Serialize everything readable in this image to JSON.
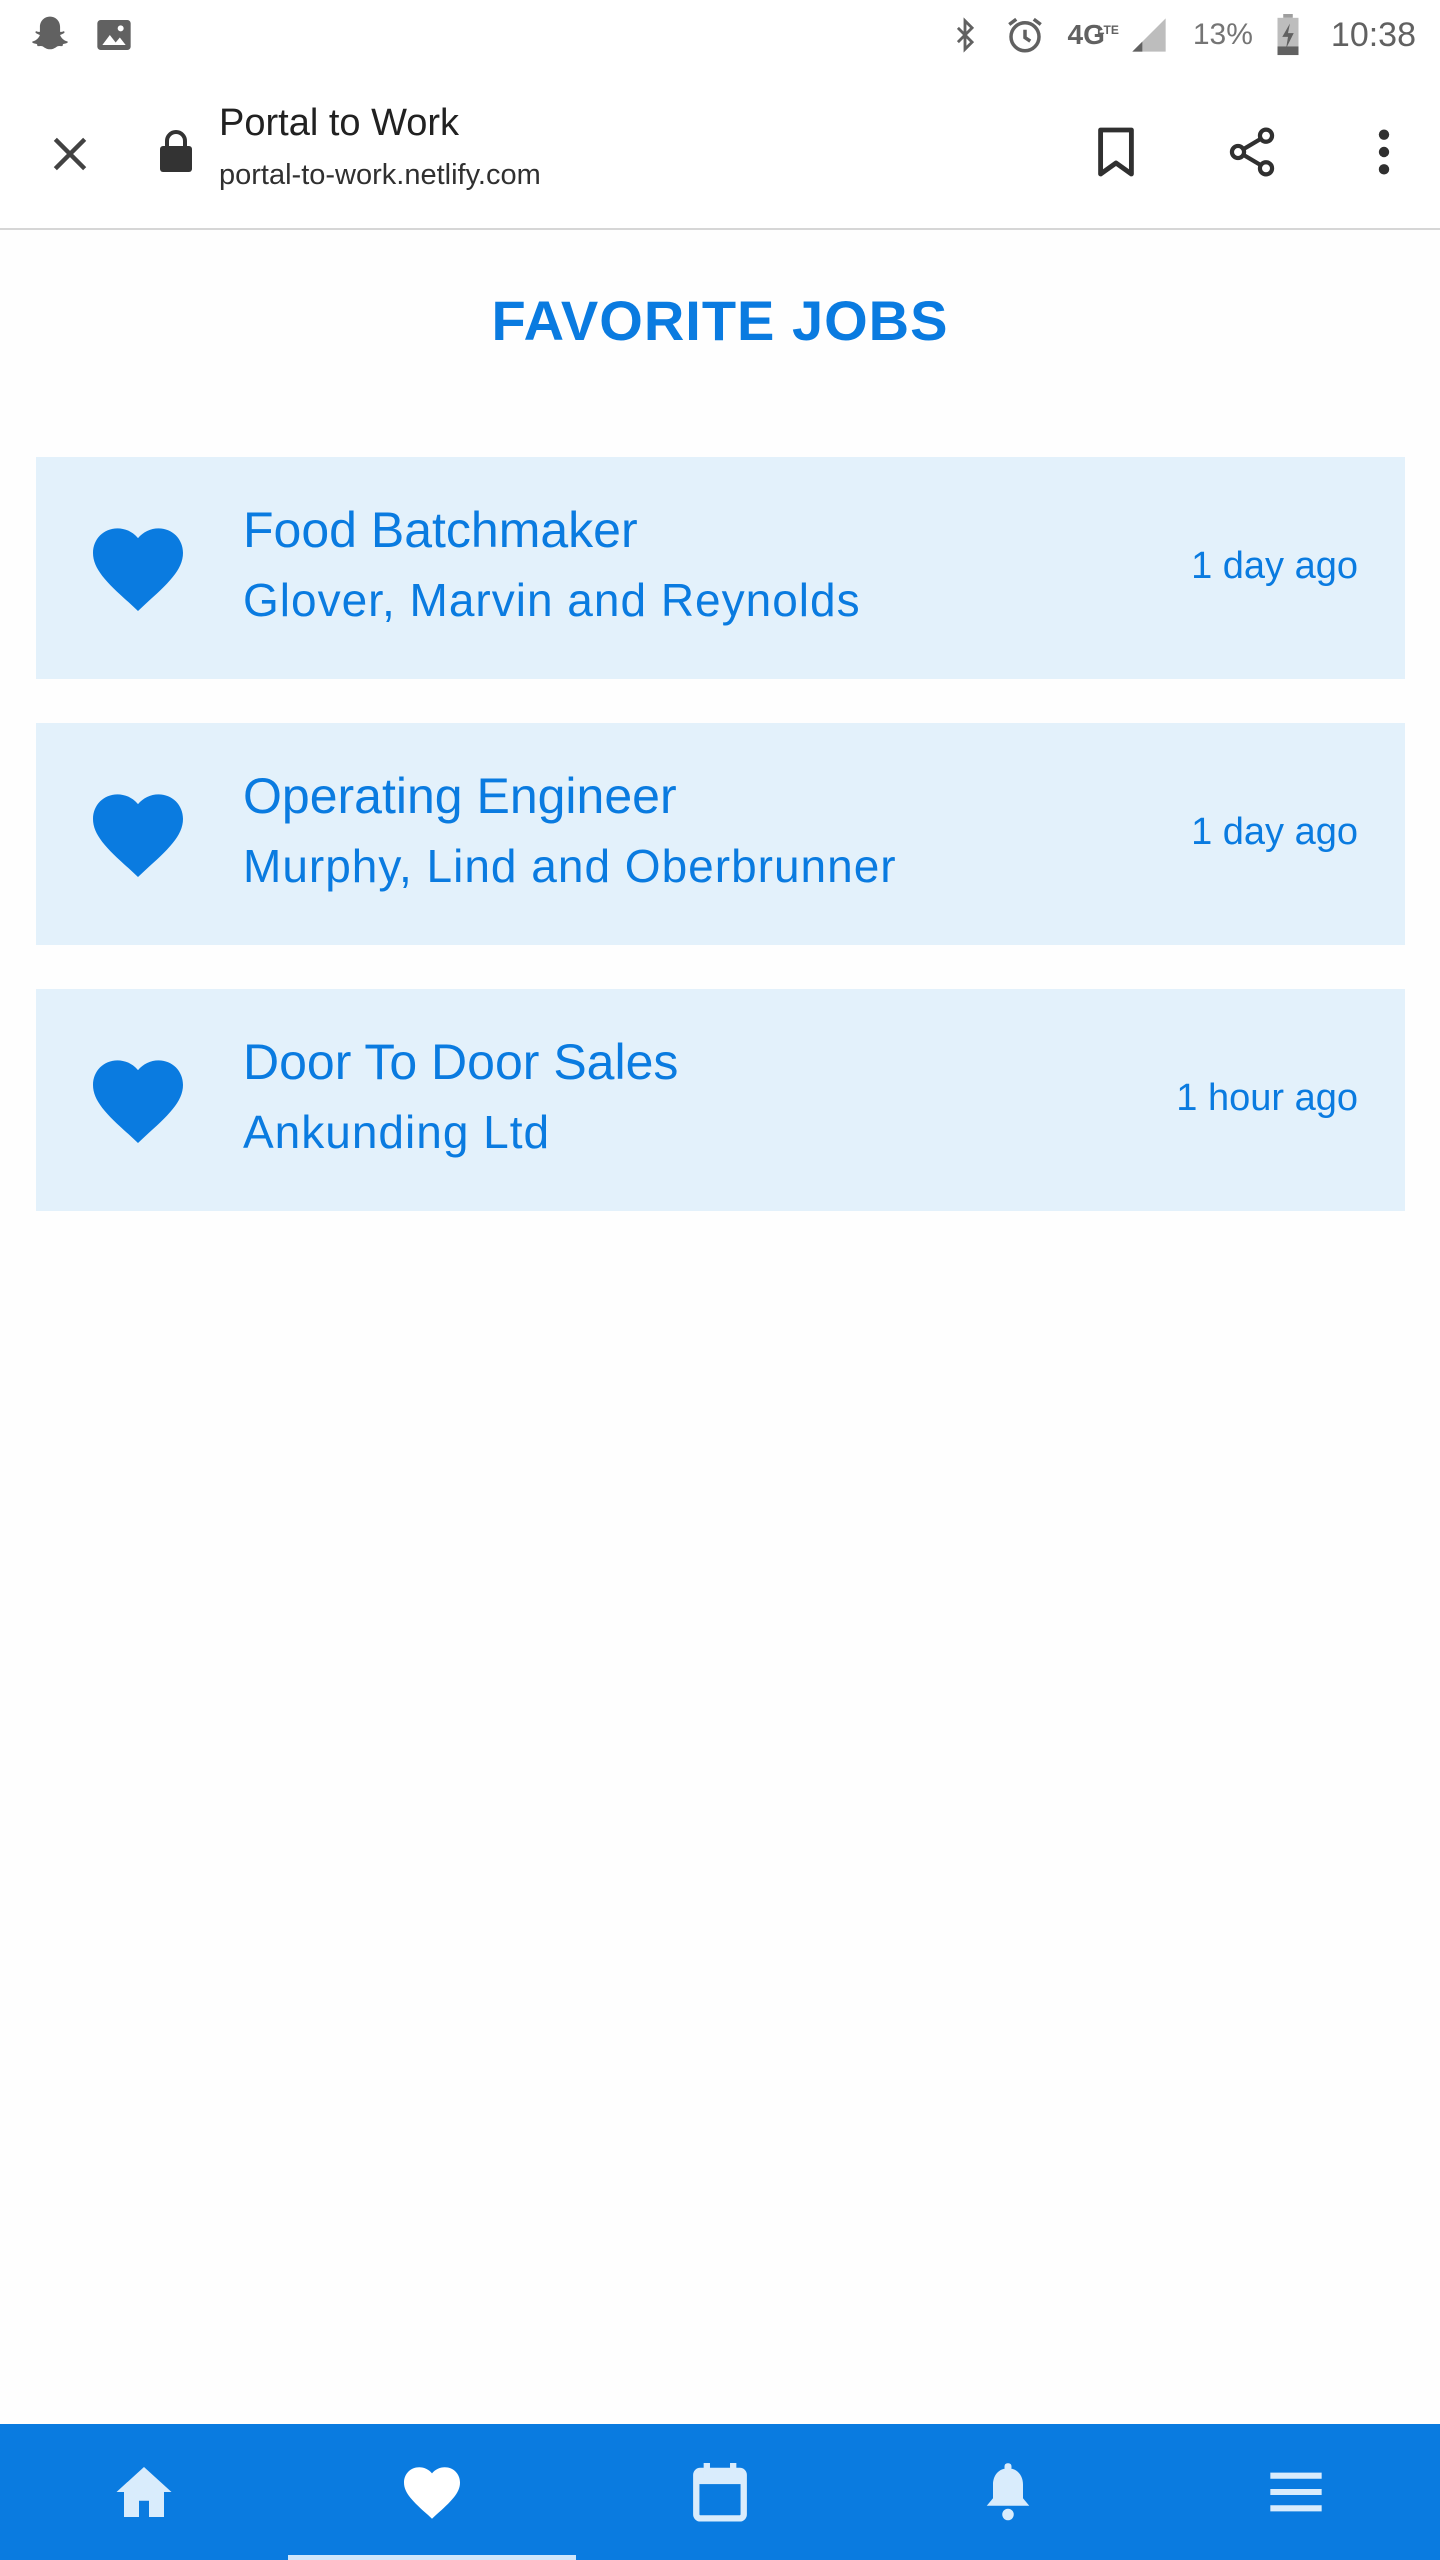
{
  "status_bar": {
    "left_icons": [
      "snapchat-ghost-icon",
      "gallery-icon"
    ],
    "network": "4G",
    "network_sub": "LTE",
    "battery_percent": "13%",
    "time": "10:38"
  },
  "browser": {
    "title": "Portal to Work",
    "url": "portal-to-work.netlify.com"
  },
  "page": {
    "heading": "FAVORITE JOBS"
  },
  "jobs": [
    {
      "title": "Food Batchmaker",
      "company": "Glover, Marvin and Reynolds",
      "posted": "1 day ago"
    },
    {
      "title": "Operating Engineer",
      "company": "Murphy, Lind and Oberbrunner",
      "posted": "1 day ago"
    },
    {
      "title": "Door To Door Sales",
      "company": "Ankunding Ltd",
      "posted": "1 hour ago"
    }
  ],
  "bottom_nav": {
    "items": [
      "home-icon",
      "heart-icon",
      "calendar-icon",
      "bell-icon",
      "menu-icon"
    ],
    "active_index": 1
  },
  "colors": {
    "accent": "#0a7be0",
    "card_background": "#e3f1fb"
  }
}
